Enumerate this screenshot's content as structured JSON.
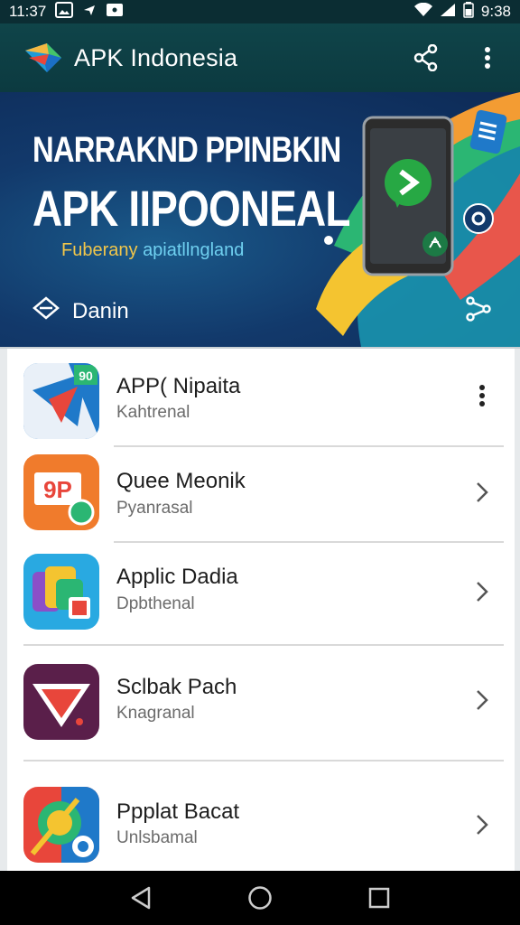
{
  "status_bar": {
    "time_left": "11:37",
    "time_right": "9:38",
    "icons": [
      "image-icon",
      "send-icon",
      "message-icon",
      "wifi-icon",
      "signal-icon",
      "battery-icon"
    ]
  },
  "app_bar": {
    "title": "APK Indonesia",
    "actions": [
      "share-icon",
      "more-vert-icon"
    ]
  },
  "banner": {
    "title_line1": "NARRAKND PPINBKIN",
    "title_line2": "APK IIPOONEAL",
    "subtitle_part1": "Fuberany ",
    "subtitle_part2": "apiatllngland",
    "cta_label": "Danin"
  },
  "apps": [
    {
      "name": "APP( Nipaita",
      "subtitle": "Kahtrenal",
      "action_icon": "more-vert-icon"
    },
    {
      "name": "Quee Meonik",
      "subtitle": "Pyanrasal",
      "action_icon": "chevron-right-icon"
    },
    {
      "name": "Applic Dadia",
      "subtitle": "Dpbthenal",
      "action_icon": "chevron-right-icon"
    },
    {
      "name": "Sclbak Pach",
      "subtitle": "Knagranal",
      "action_icon": "chevron-right-icon"
    },
    {
      "name": "Ppplat Bacat",
      "subtitle": "Unlsbamal",
      "action_icon": "chevron-right-icon"
    }
  ],
  "icon_labels": {
    "app1_badge": "90",
    "app2_badge": "9P"
  },
  "nav_bar": [
    "back-icon",
    "home-icon",
    "recents-icon"
  ],
  "colors": {
    "app_bar": "#0f4449",
    "banner_bg": "#12396b",
    "subtitle_yellow": "#f1c64a",
    "subtitle_blue": "#6fd0f0"
  }
}
